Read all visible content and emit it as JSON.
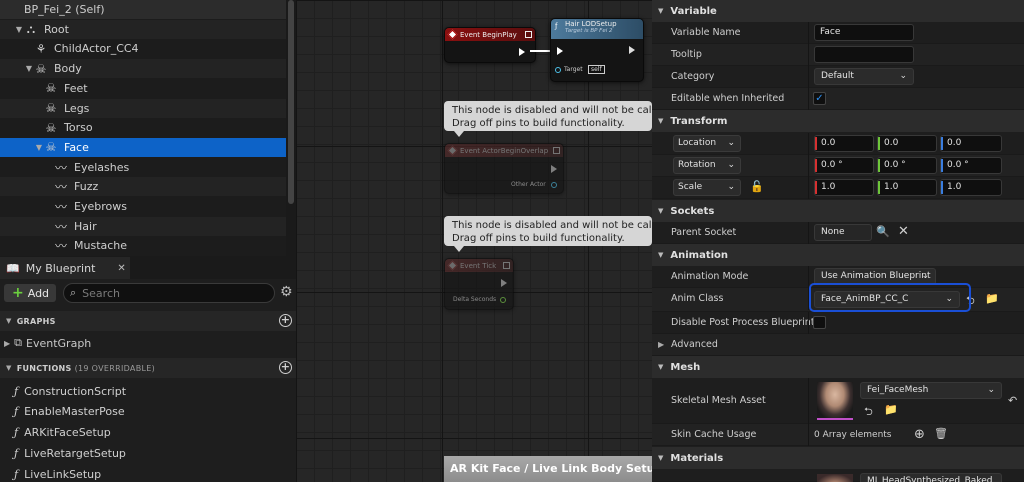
{
  "components": {
    "items": [
      {
        "label": "BP_Fei_2 (Self)",
        "icon": "self-icon",
        "indent": 0,
        "arrow": ""
      },
      {
        "label": "Root",
        "icon": "scene-root-icon",
        "indent": 1,
        "arrow": "▼"
      },
      {
        "label": "ChildActor_CC4",
        "icon": "child-actor-icon",
        "indent": 2,
        "arrow": ""
      },
      {
        "label": "Body",
        "icon": "skeleton-icon",
        "indent": 2,
        "arrow": "▼"
      },
      {
        "label": "Feet",
        "icon": "skeleton-icon",
        "indent": 3,
        "arrow": ""
      },
      {
        "label": "Legs",
        "icon": "skeleton-icon",
        "indent": 3,
        "arrow": ""
      },
      {
        "label": "Torso",
        "icon": "skeleton-icon",
        "indent": 3,
        "arrow": ""
      },
      {
        "label": "Face",
        "icon": "skeleton-icon",
        "indent": 3,
        "arrow": "▼"
      },
      {
        "label": "Eyelashes",
        "icon": "groom-icon",
        "indent": 4,
        "arrow": ""
      },
      {
        "label": "Fuzz",
        "icon": "groom-icon",
        "indent": 4,
        "arrow": ""
      },
      {
        "label": "Eyebrows",
        "icon": "groom-icon",
        "indent": 4,
        "arrow": ""
      },
      {
        "label": "Hair",
        "icon": "groom-icon",
        "indent": 4,
        "arrow": ""
      },
      {
        "label": "Mustache",
        "icon": "groom-icon",
        "indent": 4,
        "arrow": ""
      }
    ]
  },
  "my_blueprint": {
    "tab_label": "My Blueprint",
    "add_label": "Add",
    "search_placeholder": "Search",
    "graphs_header": "GRAPHS",
    "event_graph": "EventGraph",
    "functions_header": "FUNCTIONS",
    "functions_count": "(19 OVERRIDABLE)",
    "functions": [
      "ConstructionScript",
      "EnableMasterPose",
      "ARKitFaceSetup",
      "LiveRetargetSetup",
      "LiveLinkSetup"
    ]
  },
  "graph": {
    "event_begin_play": "Event BeginPlay",
    "hair_lod_title": "Hair LODSetup",
    "hair_lod_sub": "Target is BP Fei 2",
    "target_label": "Target",
    "target_value": "self",
    "disabled_comment_line1": "This node is disabled and will not be calle",
    "disabled_comment_line2": "Drag off pins to build functionality.",
    "event_actor_overlap": "Event ActorBeginOverlap",
    "other_actor": "Other Actor",
    "event_tick": "Event Tick",
    "delta_seconds": "Delta Seconds",
    "group_title": "AR Kit Face / Live Link Body Setup"
  },
  "details": {
    "variable": {
      "header": "Variable",
      "name_label": "Variable Name",
      "name_value": "Face",
      "tooltip_label": "Tooltip",
      "tooltip_value": "",
      "category_label": "Category",
      "category_value": "Default",
      "editable_label": "Editable when Inherited",
      "editable_checked": true
    },
    "transform": {
      "header": "Transform",
      "location_label": "Location",
      "location": [
        "0.0",
        "0.0",
        "0.0"
      ],
      "rotation_label": "Rotation",
      "rotation": [
        "0.0 °",
        "0.0 °",
        "0.0 °"
      ],
      "scale_label": "Scale",
      "scale": [
        "1.0",
        "1.0",
        "1.0"
      ]
    },
    "sockets": {
      "header": "Sockets",
      "parent_socket_label": "Parent Socket",
      "parent_socket_value": "None"
    },
    "animation": {
      "header": "Animation",
      "mode_label": "Animation Mode",
      "mode_value": "Use Animation Blueprint",
      "class_label": "Anim Class",
      "class_value": "Face_AnimBP_CC_C",
      "disable_pp_label": "Disable Post Process Blueprint",
      "advanced_label": "Advanced"
    },
    "mesh": {
      "header": "Mesh",
      "skeletal_label": "Skeletal Mesh Asset",
      "skeletal_value": "Fei_FaceMesh",
      "skin_cache_label": "Skin Cache Usage",
      "skin_cache_value": "0 Array elements"
    },
    "materials": {
      "header": "Materials",
      "first_value": "MI_HeadSynthesized_Baked"
    },
    "colors": {
      "x": "#d63030",
      "y": "#6ec63a",
      "z": "#3a7ee0",
      "accent": "#0d63c8",
      "highlight": "#1a4fd6"
    }
  }
}
